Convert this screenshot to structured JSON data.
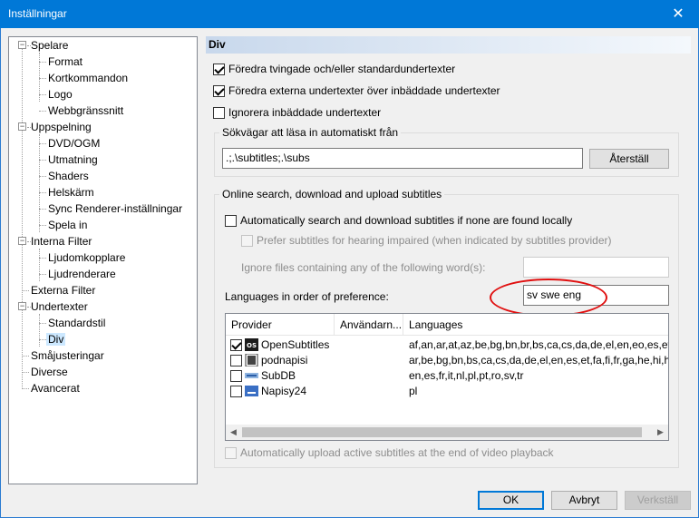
{
  "window": {
    "title": "Inställningar",
    "close_glyph": "✕"
  },
  "tree": {
    "items": [
      {
        "label": "Spelare",
        "level": 0,
        "box": "−"
      },
      {
        "label": "Format",
        "level": 1
      },
      {
        "label": "Kortkommandon",
        "level": 1
      },
      {
        "label": "Logo",
        "level": 1
      },
      {
        "label": "Webbgränssnitt",
        "level": 1
      },
      {
        "label": "Uppspelning",
        "level": 0,
        "box": "−"
      },
      {
        "label": "DVD/OGM",
        "level": 1
      },
      {
        "label": "Utmatning",
        "level": 1
      },
      {
        "label": "Shaders",
        "level": 1
      },
      {
        "label": "Helskärm",
        "level": 1
      },
      {
        "label": "Sync Renderer-inställningar",
        "level": 1
      },
      {
        "label": "Spela in",
        "level": 1
      },
      {
        "label": "Interna Filter",
        "level": 0,
        "box": "−"
      },
      {
        "label": "Ljudomkopplare",
        "level": 1
      },
      {
        "label": "Ljudrenderare",
        "level": 1
      },
      {
        "label": "Externa Filter",
        "level": 0
      },
      {
        "label": "Undertexter",
        "level": 0,
        "box": "−"
      },
      {
        "label": "Standardstil",
        "level": 1
      },
      {
        "label": "Div",
        "level": 1,
        "selected": true
      },
      {
        "label": "Småjusteringar",
        "level": 0
      },
      {
        "label": "Diverse",
        "level": 0
      },
      {
        "label": "Avancerat",
        "level": 0
      }
    ]
  },
  "panel": {
    "title": "Div",
    "options": {
      "prefer_forced": {
        "label": "Föredra tvingade och/eller standardundertexter",
        "checked": true
      },
      "prefer_external": {
        "label": "Föredra externa undertexter över inbäddade undertexter",
        "checked": true
      },
      "ignore_embedded": {
        "label": "Ignorera inbäddade undertexter",
        "checked": false
      }
    },
    "paths_group": {
      "legend": "Sökvägar att läsa in automatiskt från",
      "value": ".;.\\subtitles;.\\subs",
      "reset_label": "Återställ"
    },
    "online_group": {
      "legend": "Online search, download and upload subtitles",
      "auto_search": {
        "label": "Automatically search and download subtitles if none are found locally",
        "checked": false
      },
      "prefer_hi": {
        "label": "Prefer subtitles for hearing impaired (when indicated by subtitles provider)",
        "checked": false
      },
      "ignore_words_label": "Ignore files containing any of the following word(s):",
      "ignore_words_value": "",
      "languages_label": "Languages in order of preference:",
      "languages_value": "sv swe eng",
      "columns": [
        "Provider",
        "Användarn...",
        "Languages"
      ],
      "providers": [
        {
          "name": "OpenSubtitles",
          "user": "",
          "languages": "af,an,ar,at,az,be,bg,bn,br,bs,ca,cs,da,de,el,en,eo,es,et,eu,...",
          "checked": true,
          "icon": "opensubtitles-icon"
        },
        {
          "name": "podnapisi",
          "user": "",
          "languages": "ar,be,bg,bn,bs,ca,cs,da,de,el,en,es,et,fa,fi,fr,ga,he,hi,hr,hu,...",
          "checked": false,
          "icon": "podnapisi-icon"
        },
        {
          "name": "SubDB",
          "user": "",
          "languages": "en,es,fr,it,nl,pl,pt,ro,sv,tr",
          "checked": false,
          "icon": "subdb-icon"
        },
        {
          "name": "Napisy24",
          "user": "",
          "languages": "pl",
          "checked": false,
          "icon": "napisy24-icon"
        }
      ],
      "auto_upload": {
        "label": "Automatically upload active subtitles at the end of video playback",
        "checked": false
      }
    }
  },
  "footer": {
    "ok": "OK",
    "cancel": "Avbryt",
    "apply": "Verkställ"
  },
  "colors": {
    "titlebar": "#0078d7",
    "selection": "#cce8ff",
    "annotation": "#e01010"
  }
}
